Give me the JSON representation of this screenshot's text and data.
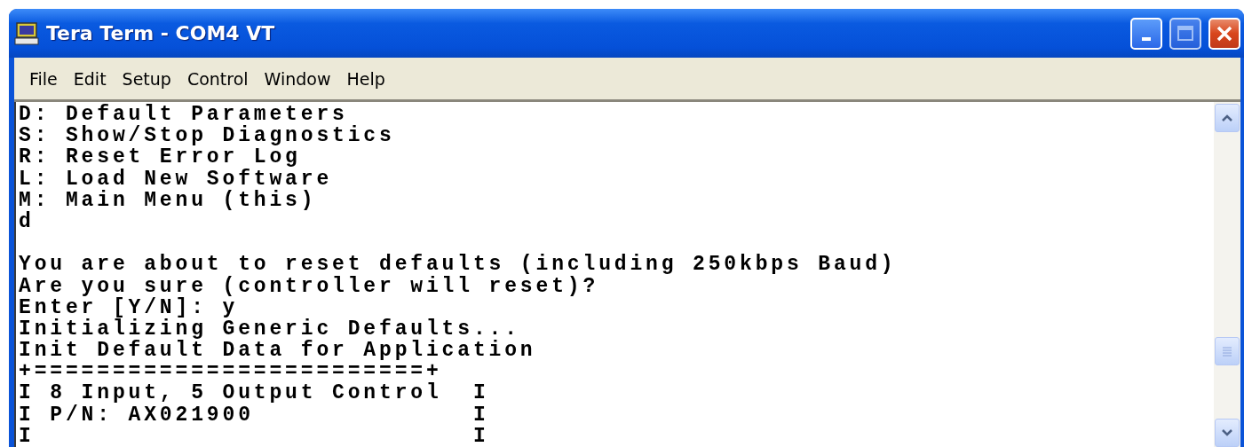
{
  "window": {
    "title": "Tera Term - COM4 VT"
  },
  "menu": [
    "File",
    "Edit",
    "Setup",
    "Control",
    "Window",
    "Help"
  ],
  "terminal": {
    "lines": [
      {
        "kind": "text",
        "text": "D: Default Parameters"
      },
      {
        "kind": "text",
        "text": "S: Show/Stop Diagnostics"
      },
      {
        "kind": "text",
        "text": "R: Reset Error Log"
      },
      {
        "kind": "text",
        "text": "L: Load New Software"
      },
      {
        "kind": "text",
        "text": "M: Main Menu (this)"
      },
      {
        "kind": "text",
        "text": "d"
      },
      {
        "kind": "blank"
      },
      {
        "kind": "text",
        "text": "You are about to reset defaults (including 250kbps Baud)"
      },
      {
        "kind": "text",
        "text": "Are you sure (controller will reset)?"
      },
      {
        "kind": "text",
        "text": "Enter [Y/N]: y"
      },
      {
        "kind": "text",
        "text": "Initializing Generic Defaults..."
      },
      {
        "kind": "text",
        "text": "Init Default Data for Application"
      },
      {
        "kind": "text",
        "text": "+=========================+"
      },
      {
        "kind": "text",
        "text": "I 8 Input, 5 Output Control  I"
      },
      {
        "kind": "text",
        "text": "I P/N: AX021900              I"
      },
      {
        "kind": "text",
        "text": "I                            I"
      }
    ]
  }
}
